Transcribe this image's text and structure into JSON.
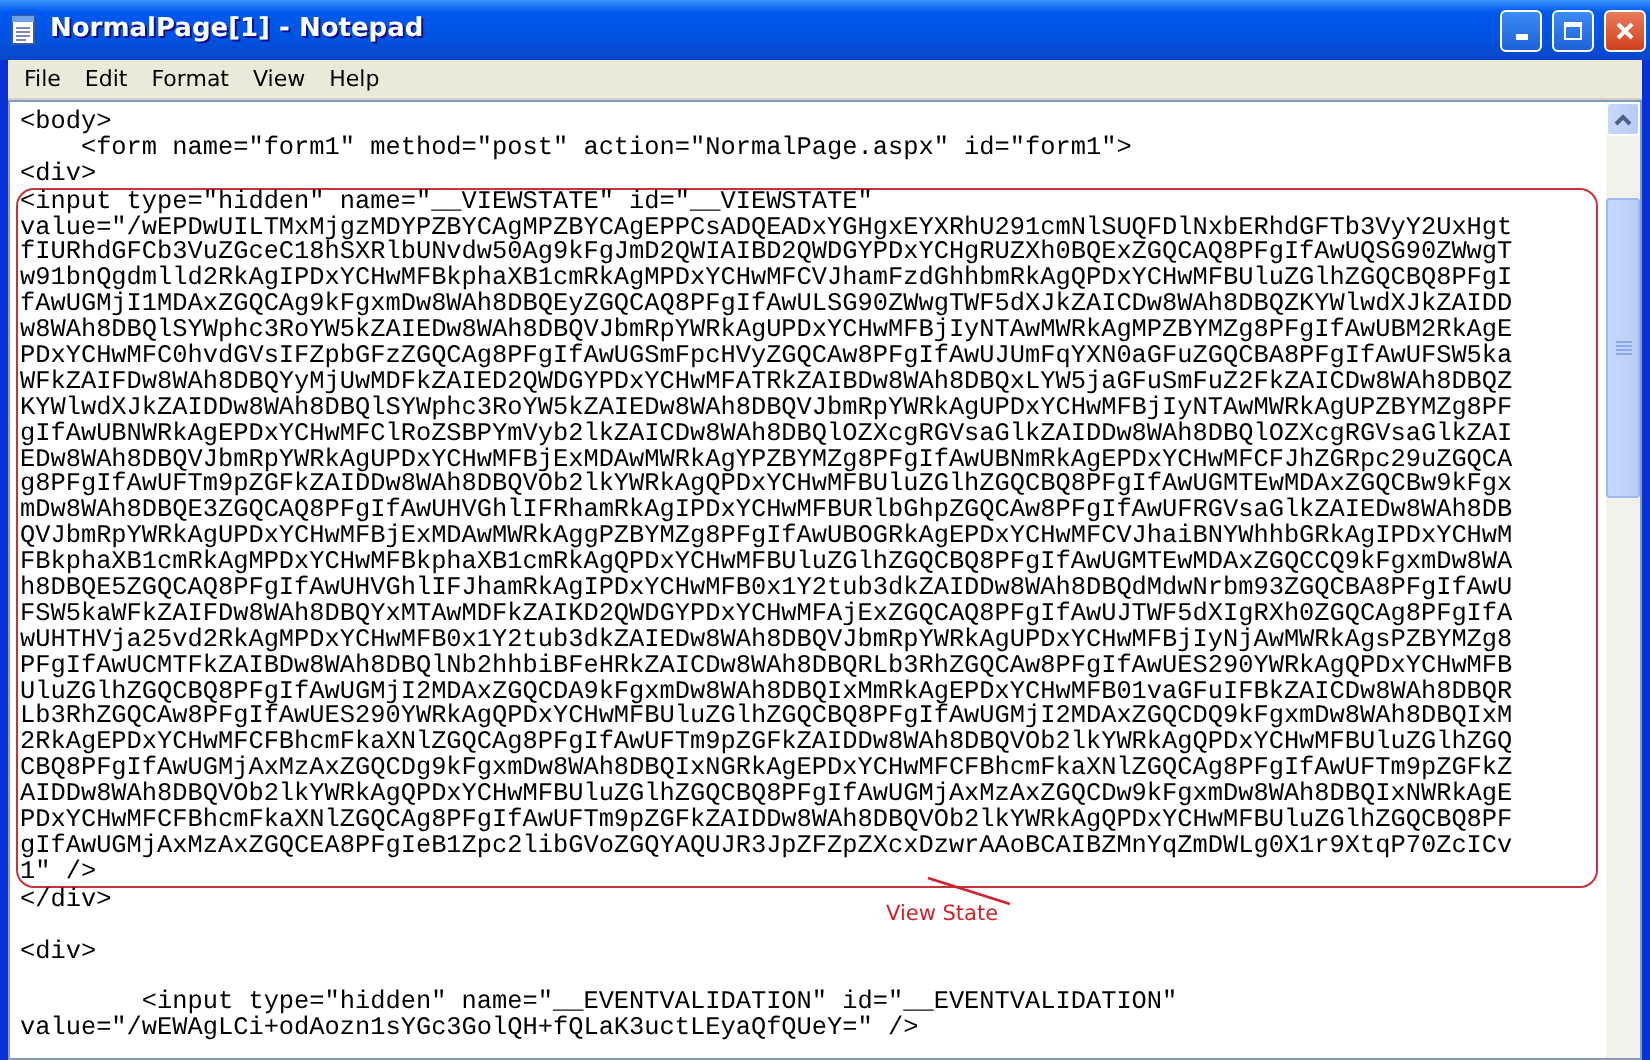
{
  "window": {
    "title": "NormalPage[1] - Notepad"
  },
  "menu": [
    {
      "label": "File"
    },
    {
      "label": "Edit"
    },
    {
      "label": "Format"
    },
    {
      "label": "View"
    },
    {
      "label": "Help"
    }
  ],
  "editor": {
    "lines_before": [
      "<body>",
      "    <form name=\"form1\" method=\"post\" action=\"NormalPage.aspx\" id=\"form1\">",
      "<div>"
    ],
    "callout": {
      "label": "View State",
      "lines": [
        "<input type=\"hidden\" name=\"__VIEWSTATE\" id=\"__VIEWSTATE\"",
        "value=\"/wEPDwUILTMxMjgzMDYPZBYCAgMPZBYCAgEPPCsADQEADxYGHgxEYXRhU291cmNlSUQFDlNxbERhdGFTb3VyY2UxHgt",
        "fIURhdGFCb3VuZGceC18hSXRlbUNvdw50Ag9kFgJmD2QWIAIBD2QWDGYPDxYCHgRUZXh0BQExZGQCAQ8PFgIfAwUQSG90ZWwgT",
        "w91bnQgdmlld2RkAgIPDxYCHwMFBkphaXB1cmRkAgMPDxYCHwMFCVJhamFzdGhhbmRkAgQPDxYCHwMFBUluZGlhZGQCBQ8PFgI",
        "fAwUGMjI1MDAxZGQCAg9kFgxmDw8WAh8DBQEyZGQCAQ8PFgIfAwULSG90ZWwgTWF5dXJkZAICDw8WAh8DBQZKYWlwdXJkZAIDD",
        "w8WAh8DBQlSYWphc3RoYW5kZAIEDw8WAh8DBQVJbmRpYWRkAgUPDxYCHwMFBjIyNTAwMWRkAgMPZBYMZg8PFgIfAwUBM2RkAgE",
        "PDxYCHwMFC0hvdGVsIFZpbGFzZGQCAg8PFgIfAwUGSmFpcHVyZGQCAw8PFgIfAwUJUmFqYXN0aGFuZGQCBA8PFgIfAwUFSW5ka",
        "WFkZAIFDw8WAh8DBQYyMjUwMDFkZAIED2QWDGYPDxYCHwMFATRkZAIBDw8WAh8DBQxLYW5jaGFuSmFuZ2FkZAICDw8WAh8DBQZ",
        "KYWlwdXJkZAIDDw8WAh8DBQlSYWphc3RoYW5kZAIEDw8WAh8DBQVJbmRpYWRkAgUPDxYCHwMFBjIyNTAwMWRkAgUPZBYMZg8PF",
        "gIfAwUBNWRkAgEPDxYCHwMFClRoZSBPYmVyb2lkZAICDw8WAh8DBQlOZXcgRGVsaGlkZAIDDw8WAh8DBQlOZXcgRGVsaGlkZAI",
        "EDw8WAh8DBQVJbmRpYWRkAgUPDxYCHwMFBjExMDAwMWRkAgYPZBYMZg8PFgIfAwUBNmRkAgEPDxYCHwMFCFJhZGRpc29uZGQCA",
        "g8PFgIfAwUFTm9pZGFkZAIDDw8WAh8DBQVOb2lkYWRkAgQPDxYCHwMFBUluZGlhZGQCBQ8PFgIfAwUGMTEwMDAxZGQCBw9kFgx",
        "mDw8WAh8DBQE3ZGQCAQ8PFgIfAwUHVGhlIFRhamRkAgIPDxYCHwMFBURlbGhpZGQCAw8PFgIfAwUFRGVsaGlkZAIEDw8WAh8DB",
        "QVJbmRpYWRkAgUPDxYCHwMFBjExMDAwMWRkAggPZBYMZg8PFgIfAwUBOGRkAgEPDxYCHwMFCVJhaiBNYWhhbGRkAgIPDxYCHwM",
        "FBkphaXB1cmRkAgMPDxYCHwMFBkphaXB1cmRkAgQPDxYCHwMFBUluZGlhZGQCBQ8PFgIfAwUGMTEwMDAxZGQCCQ9kFgxmDw8WA",
        "h8DBQE5ZGQCAQ8PFgIfAwUHVGhlIFJhamRkAgIPDxYCHwMFB0x1Y2tub3dkZAIDDw8WAh8DBQdMdwNrbm93ZGQCBA8PFgIfAwU",
        "FSW5kaWFkZAIFDw8WAh8DBQYxMTAwMDFkZAIKD2QWDGYPDxYCHwMFAjExZGQCAQ8PFgIfAwUJTWF5dXIgRXh0ZGQCAg8PFgIfA",
        "wUHTHVja25vd2RkAgMPDxYCHwMFB0x1Y2tub3dkZAIEDw8WAh8DBQVJbmRpYWRkAgUPDxYCHwMFBjIyNjAwMWRkAgsPZBYMZg8",
        "PFgIfAwUCMTFkZAIBDw8WAh8DBQlNb2hhbiBFeHRkZAICDw8WAh8DBQRLb3RhZGQCAw8PFgIfAwUES290YWRkAgQPDxYCHwMFB",
        "UluZGlhZGQCBQ8PFgIfAwUGMjI2MDAxZGQCDA9kFgxmDw8WAh8DBQIxMmRkAgEPDxYCHwMFB01vaGFuIFBkZAICDw8WAh8DBQR",
        "Lb3RhZGQCAw8PFgIfAwUES290YWRkAgQPDxYCHwMFBUluZGlhZGQCBQ8PFgIfAwUGMjI2MDAxZGQCDQ9kFgxmDw8WAh8DBQIxM",
        "2RkAgEPDxYCHwMFCFBhcmFkaXNlZGQCAg8PFgIfAwUFTm9pZGFkZAIDDw8WAh8DBQVOb2lkYWRkAgQPDxYCHwMFBUluZGlhZGQ",
        "CBQ8PFgIfAwUGMjAxMzAxZGQCDg9kFgxmDw8WAh8DBQIxNGRkAgEPDxYCHwMFCFBhcmFkaXNlZGQCAg8PFgIfAwUFTm9pZGFkZ",
        "AIDDw8WAh8DBQVOb2lkYWRkAgQPDxYCHwMFBUluZGlhZGQCBQ8PFgIfAwUGMjAxMzAxZGQCDw9kFgxmDw8WAh8DBQIxNWRkAgE",
        "PDxYCHwMFCFBhcmFkaXNlZGQCAg8PFgIfAwUFTm9pZGFkZAIDDw8WAh8DBQVOb2lkYWRkAgQPDxYCHwMFBUluZGlhZGQCBQ8PF",
        "gIfAwUGMjAxMzAxZGQCEA8PFgIeB1Zpc2libGVoZGQYAQUJR3JpZFZpZXcxDzwrAAoBCAIBZMnYqZmDWLg0X1r9XtqP70ZcICv",
        "1\" />"
      ]
    },
    "lines_after": [
      [
        "</div>"
      ],
      [
        "<div>"
      ],
      [
        "        <input type=\"hidden\" name=\"__EVENTVALIDATION\" id=\"__EVENTVALIDATION\"",
        "value=\"/wEWAgLCi+odAozn1sYGc3GolQH+fQLaK3uctLEyaQfQUeY=\" />"
      ]
    ]
  }
}
